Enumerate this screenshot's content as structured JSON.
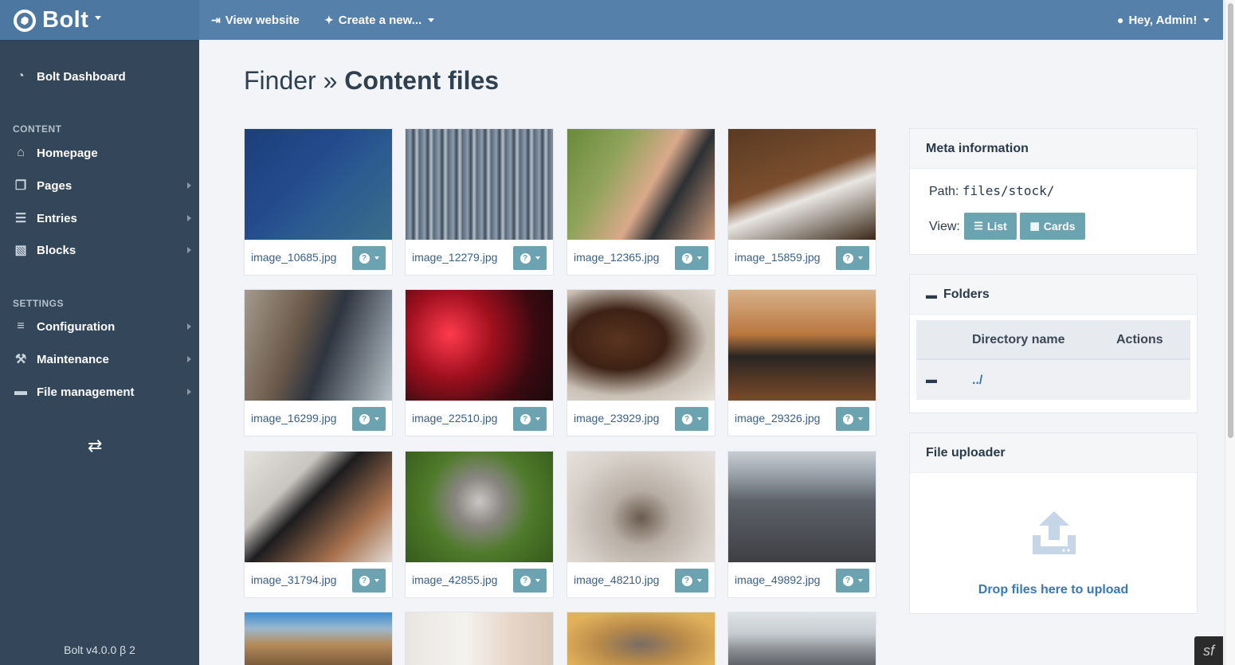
{
  "brand": {
    "name": "Bolt"
  },
  "topnav": {
    "view_website": "View website",
    "create_new": "Create a new...",
    "user": "Hey, Admin!"
  },
  "sidebar": {
    "dashboard": "Bolt Dashboard",
    "content_heading": "CONTENT",
    "content_items": [
      {
        "label": "Homepage",
        "icon": "home-icon",
        "submenu": false
      },
      {
        "label": "Pages",
        "icon": "pages-icon",
        "submenu": true
      },
      {
        "label": "Entries",
        "icon": "entries-icon",
        "submenu": true
      },
      {
        "label": "Blocks",
        "icon": "blocks-icon",
        "submenu": true
      }
    ],
    "settings_heading": "SETTINGS",
    "settings_items": [
      {
        "label": "Configuration",
        "icon": "sliders-icon",
        "submenu": true
      },
      {
        "label": "Maintenance",
        "icon": "tools-icon",
        "submenu": true
      },
      {
        "label": "File management",
        "icon": "folder-open-icon",
        "submenu": true
      }
    ],
    "version": "Bolt v4.0.0 β 2"
  },
  "page": {
    "title_prefix": "Finder »",
    "title_main": "Content files"
  },
  "files": [
    {
      "name": "image_10685.jpg"
    },
    {
      "name": "image_12279.jpg"
    },
    {
      "name": "image_12365.jpg"
    },
    {
      "name": "image_15859.jpg"
    },
    {
      "name": "image_16299.jpg"
    },
    {
      "name": "image_22510.jpg"
    },
    {
      "name": "image_23929.jpg"
    },
    {
      "name": "image_29326.jpg"
    },
    {
      "name": "image_31794.jpg"
    },
    {
      "name": "image_42855.jpg"
    },
    {
      "name": "image_48210.jpg"
    },
    {
      "name": "image_49892.jpg"
    }
  ],
  "meta": {
    "heading": "Meta information",
    "path_label": "Path:",
    "path_value": "files/stock/",
    "view_label": "View:",
    "list_label": "List",
    "cards_label": "Cards"
  },
  "folders": {
    "heading": "Folders",
    "col_directory": "Directory name",
    "col_actions": "Actions",
    "rows": [
      {
        "name": "../"
      }
    ]
  },
  "uploader": {
    "heading": "File uploader",
    "drop_text": "Drop files here to upload"
  },
  "colors": {
    "topbar": "#5480aa",
    "sidebar": "#34465a",
    "button": "#6ca3b0",
    "link": "#3a78b1"
  }
}
